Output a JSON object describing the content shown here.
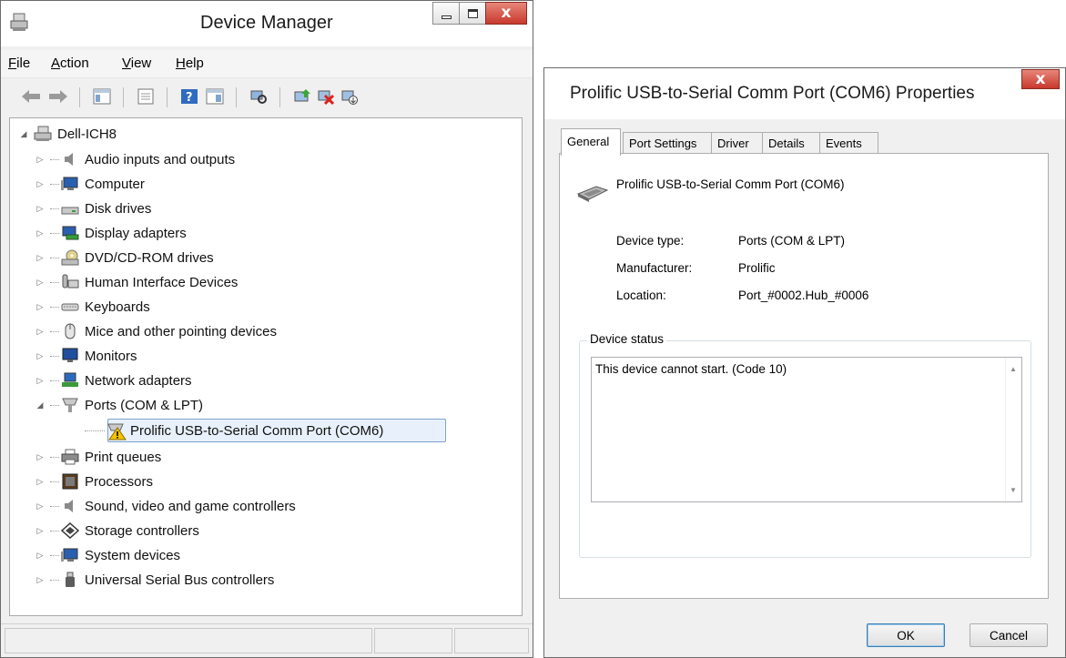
{
  "device_manager": {
    "title": "Device Manager",
    "menu": [
      {
        "key": "F",
        "rest": "ile"
      },
      {
        "key": "A",
        "rest": "ction"
      },
      {
        "key": "V",
        "rest": "iew"
      },
      {
        "key": "H",
        "rest": "elp"
      }
    ],
    "toolbar_icons": [
      "back-arrow-icon",
      "forward-arrow-icon",
      "show-hide-console-tree-icon",
      "properties-icon",
      "help-icon",
      "action-pane-icon",
      "scan-hardware-icon",
      "update-driver-icon",
      "uninstall-icon",
      "enable-device-icon"
    ],
    "tree": {
      "root": "Dell-ICH8",
      "categories": [
        "Audio inputs and outputs",
        "Computer",
        "Disk drives",
        "Display adapters",
        "DVD/CD-ROM drives",
        "Human Interface Devices",
        "Keyboards",
        "Mice and other pointing devices",
        "Monitors",
        "Network adapters",
        "Ports (COM & LPT)",
        "Print queues",
        "Processors",
        "Sound, video and game controllers",
        "Storage controllers",
        "System devices",
        "Universal Serial Bus controllers"
      ],
      "ports_child": "Prolific USB-to-Serial Comm Port (COM6)"
    }
  },
  "properties": {
    "title": "Prolific USB-to-Serial Comm Port (COM6) Properties",
    "tabs": [
      "General",
      "Port Settings",
      "Driver",
      "Details",
      "Events"
    ],
    "device_name": "Prolific USB-to-Serial Comm Port (COM6)",
    "fields": [
      {
        "label": "Device type:",
        "value": "Ports (COM & LPT)"
      },
      {
        "label": "Manufacturer:",
        "value": "Prolific"
      },
      {
        "label": "Location:",
        "value": "Port_#0002.Hub_#0006"
      }
    ],
    "status_group_title": "Device status",
    "status_text": "This device cannot start. (Code 10)",
    "ok_label": "OK",
    "cancel_label": "Cancel"
  },
  "colors": {
    "selection_fill": "#e8f1fb",
    "selection_border": "#7da2ce",
    "close_button": "#c7392c",
    "warning": "#f5c400"
  }
}
